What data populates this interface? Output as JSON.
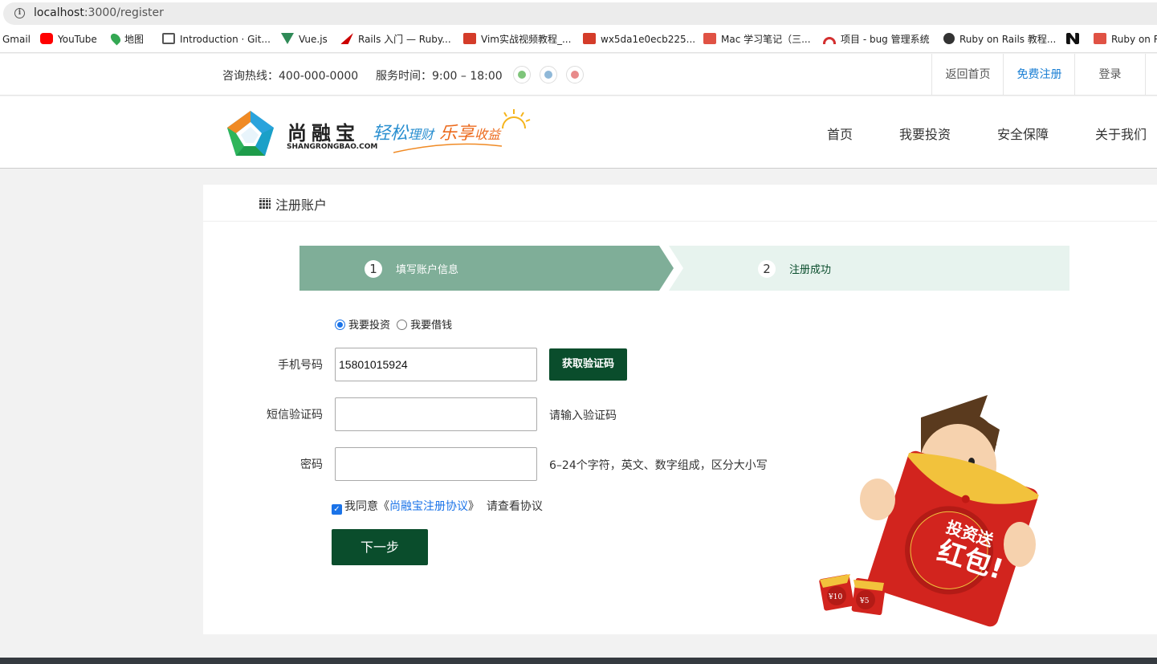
{
  "browser": {
    "url_host": "localhost",
    "url_path": ":3000/register",
    "bookmarks": [
      {
        "label": "Gmail",
        "icon": "gmail-icon",
        "color": ""
      },
      {
        "label": "YouTube",
        "icon": "youtube-icon",
        "color": "#ff0000"
      },
      {
        "label": "地图",
        "icon": "maps-icon",
        "color": "#34a853"
      },
      {
        "label": "Introduction · Git...",
        "icon": "book-icon",
        "color": "#555555"
      },
      {
        "label": "Vue.js",
        "icon": "vue-icon",
        "color": "#2f8a57"
      },
      {
        "label": "Rails 入门 — Ruby...",
        "icon": "rails-icon",
        "color": "#cc0000"
      },
      {
        "label": "Vim实战视频教程_...",
        "icon": "51-icon",
        "color": "#d43c2a"
      },
      {
        "label": "wx5da1e0ecb225...",
        "icon": "51-icon",
        "color": "#d43c2a"
      },
      {
        "label": "Mac 学习笔记（三...",
        "icon": "jian-icon",
        "color": "#e05244"
      },
      {
        "label": "项目 - bug 管理系统",
        "icon": "rainbow-icon",
        "color": "#d32f2f"
      },
      {
        "label": "Ruby on Rails 教程...",
        "icon": "globe-icon",
        "color": "#333333"
      },
      {
        "label": "",
        "icon": "n-icon",
        "color": "#111111"
      },
      {
        "label": "Ruby on R",
        "icon": "jian-icon",
        "color": "#e05244"
      }
    ]
  },
  "topbar": {
    "hotline": "咨询热线：400-000-0000",
    "service_time": "服务时间：9:00 – 18:00",
    "social": [
      {
        "name": "wechat-icon",
        "color": "#7ec57a"
      },
      {
        "name": "qq-icon",
        "color": "#8fb8d8"
      },
      {
        "name": "weibo-icon",
        "color": "#e88a8a"
      }
    ],
    "links": [
      {
        "label": "返回首页",
        "color": "#555555"
      },
      {
        "label": "免费注册",
        "color": "#1a7fd4"
      },
      {
        "label": "登录",
        "color": "#555555"
      }
    ]
  },
  "header": {
    "brand_cn": "尚融宝",
    "brand_en": "SHANGRONGBAO.COM",
    "slogan": {
      "part1": "轻松",
      "part2": "理财",
      "part3": "乐享",
      "part4": "收益"
    },
    "nav": [
      "首页",
      "我要投资",
      "安全保障",
      "关于我们"
    ]
  },
  "register": {
    "title": "注册账户",
    "steps": [
      {
        "num": "1",
        "label": "填写账户信息"
      },
      {
        "num": "2",
        "label": "注册成功"
      }
    ],
    "roles": [
      {
        "label": "我要投资",
        "selected": true
      },
      {
        "label": "我要借钱",
        "selected": false
      }
    ],
    "phone_label": "手机号码",
    "phone_value": "15801015924",
    "get_code_button": "获取验证码",
    "code_label": "短信验证码",
    "code_hint": "请输入验证码",
    "password_label": "密码",
    "password_hint": "6–24个字符，英文、数字组成，区分大小写",
    "agree_prefix": "我同意《",
    "agree_link": "尚融宝注册协议",
    "agree_suffix": "》  请查看协议",
    "next_button": "下一步"
  },
  "promo": {
    "line1": "投资送",
    "line2": "红包!",
    "coupon1": "¥10",
    "coupon2": "¥5"
  },
  "colors": {
    "primary_dark_green": "#0a4d2c",
    "step_active": "#7fae98",
    "step_inactive": "#e7f3ee",
    "link_blue": "#1a7fd4"
  }
}
